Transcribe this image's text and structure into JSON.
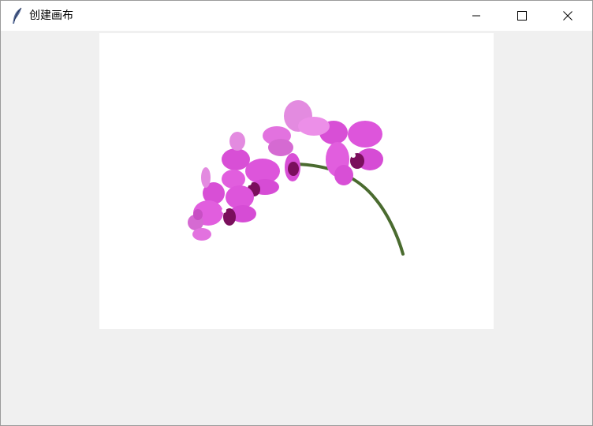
{
  "window": {
    "title": "创建画布",
    "app_icon": "feather-icon",
    "controls": [
      {
        "name": "minimize",
        "icon": "minimize-icon"
      },
      {
        "name": "maximize",
        "icon": "maximize-icon"
      },
      {
        "name": "close",
        "icon": "close-icon"
      }
    ]
  },
  "canvas": {
    "background": "#ffffff",
    "image": "orchid-image"
  },
  "colors": {
    "client_bg": "#f0f0f0",
    "petal": "#d84fd6",
    "petal_light": "#ec8fe8",
    "lip": "#7a0f5c",
    "stem": "#4a6b2f"
  }
}
